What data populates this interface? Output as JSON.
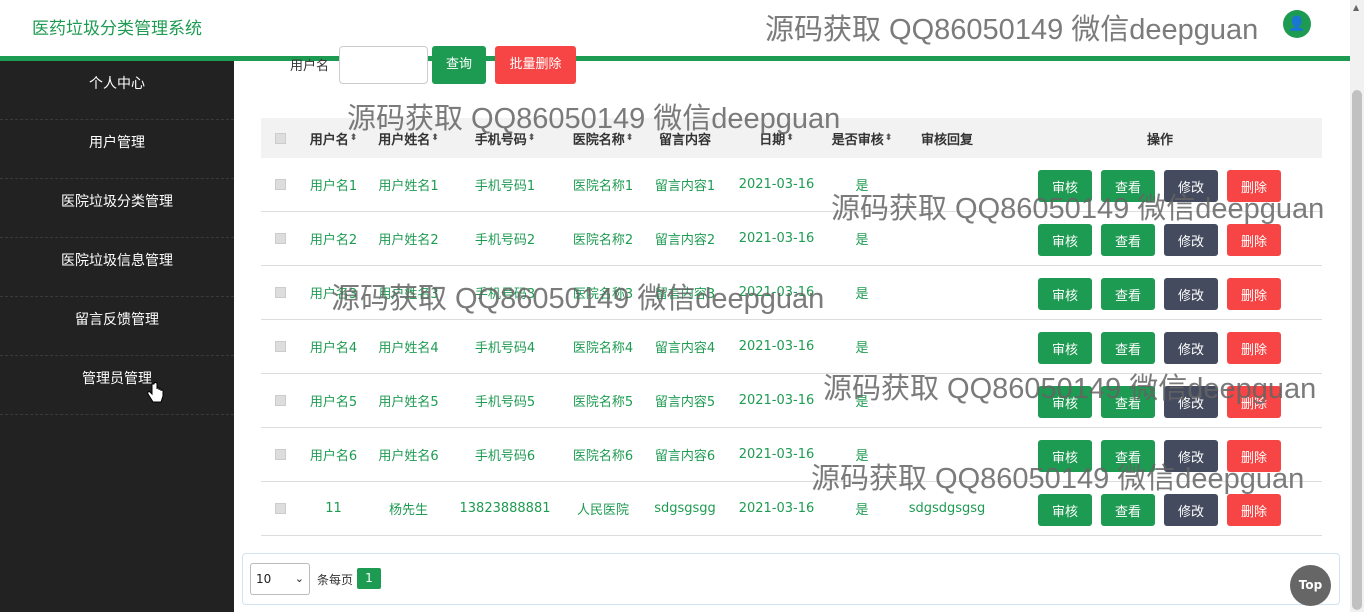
{
  "app": {
    "title": "医药垃圾分类管理系统",
    "avatar": "👤"
  },
  "sidebar": {
    "items": [
      {
        "label": "个人中心"
      },
      {
        "label": "用户管理"
      },
      {
        "label": "医院垃圾分类管理"
      },
      {
        "label": "医院垃圾信息管理"
      },
      {
        "label": "留言反馈管理"
      },
      {
        "label": "管理员管理"
      }
    ]
  },
  "search": {
    "label": "用户名",
    "value": "",
    "query_label": "查询",
    "batch_delete_label": "批量删除"
  },
  "table": {
    "headers": [
      "用户名",
      "用户姓名",
      "手机号码",
      "医院名称",
      "留言内容",
      "日期",
      "是否审核",
      "审核回复",
      "操作"
    ],
    "sortable": [
      true,
      true,
      true,
      true,
      false,
      true,
      true,
      false,
      false
    ],
    "sort_icon": "⬍",
    "rows": [
      [
        "用户名1",
        "用户姓名1",
        "手机号码1",
        "医院名称1",
        "留言内容1",
        "2021-03-16",
        "是",
        ""
      ],
      [
        "用户名2",
        "用户姓名2",
        "手机号码2",
        "医院名称2",
        "留言内容2",
        "2021-03-16",
        "是",
        ""
      ],
      [
        "用户名3",
        "用户姓名3",
        "手机号码3",
        "医院名称3",
        "留言内容3",
        "2021-03-16",
        "是",
        ""
      ],
      [
        "用户名4",
        "用户姓名4",
        "手机号码4",
        "医院名称4",
        "留言内容4",
        "2021-03-16",
        "是",
        ""
      ],
      [
        "用户名5",
        "用户姓名5",
        "手机号码5",
        "医院名称5",
        "留言内容5",
        "2021-03-16",
        "是",
        ""
      ],
      [
        "用户名6",
        "用户姓名6",
        "手机号码6",
        "医院名称6",
        "留言内容6",
        "2021-03-16",
        "是",
        ""
      ],
      [
        "11",
        "杨先生",
        "13823888881",
        "人民医院",
        "sdgsgsgg",
        "2021-03-16",
        "是",
        "sdgsdgsgsg"
      ]
    ],
    "actions": {
      "audit": "审核",
      "view": "查看",
      "edit": "修改",
      "delete": "删除"
    }
  },
  "pagination": {
    "page_size": "10",
    "per_page_label": "条每页",
    "current_page": "1"
  },
  "top_button": "Top",
  "watermark": "源码获取 QQ86050149 微信deepguan",
  "colors": {
    "primary": "#1e9b52",
    "danger": "#f74545",
    "dark": "#454b5f",
    "sidebar": "#222222"
  }
}
